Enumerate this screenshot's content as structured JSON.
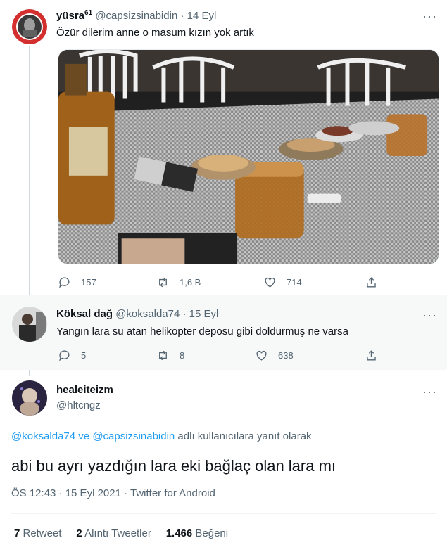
{
  "tweet1": {
    "name": "yüsra",
    "name_suffix": "61",
    "handle": "@capsizsinabidin",
    "separator": "·",
    "time": "14 Eyl",
    "more": "···",
    "text": "Özür dilerim anne o masum kızın yok artık",
    "reply_count": "157",
    "retweet_count": "1,6 B",
    "like_count": "714"
  },
  "tweet2": {
    "name": "Köksal dağ",
    "handle": "@koksalda74",
    "separator": "·",
    "time": "15 Eyl",
    "more": "···",
    "text": "Yangın lara su atan helikopter deposu gibi doldurmuş ne varsa",
    "reply_count": "5",
    "retweet_count": "8",
    "like_count": "638"
  },
  "main": {
    "name": "healeiteizm",
    "handle": "@hltcngz",
    "more": "···",
    "reply_to_1": "@koksalda74",
    "reply_joiner": " ve ",
    "reply_to_2": "@capsizsinabidin",
    "reply_suffix": " adlı kullanıcılara yanıt olarak",
    "text": "abi bu ayrı yazdığın lara eki bağlaç olan lara mı",
    "meta": "ÖS 12:43 · 15 Eyl 2021 · Twitter for Android",
    "retweets_count": "7",
    "retweets_label": " Retweet",
    "quotes_count": "2",
    "quotes_label": " Alıntı Tweetler",
    "likes_count": "1.466",
    "likes_label": " Beğeni"
  },
  "colors": {
    "accent": "#1d9bf0",
    "secondary_text": "#536471",
    "avatar_ring": "#e0245e"
  }
}
